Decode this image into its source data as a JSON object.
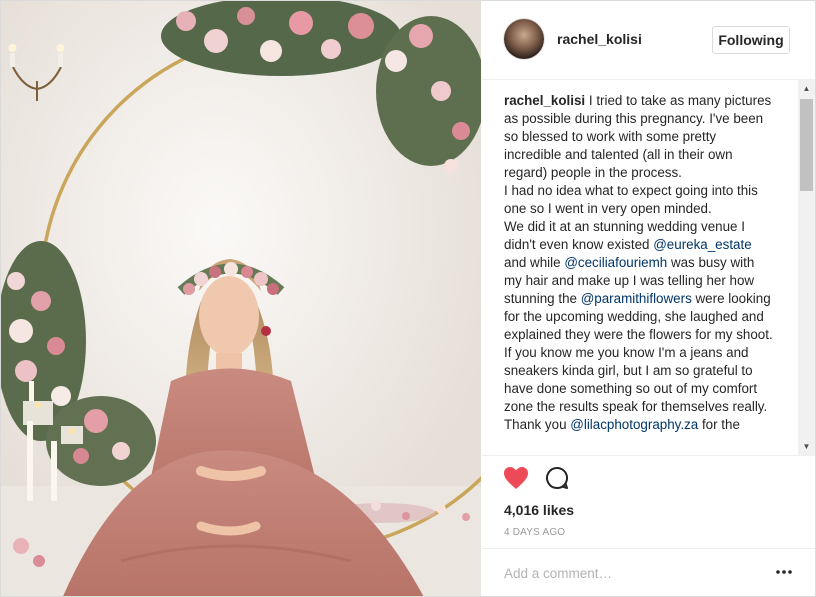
{
  "post": {
    "username": "rachel_kolisi",
    "follow_label": "Following",
    "caption_user": "rachel_kolisi",
    "caption_lines": [
      [
        {
          "t": "I tried to take as many pictures as possible during this pregnancy. I've been so blessed to work with some pretty incredible and talented (all in their own regard) people in the process."
        }
      ],
      [
        {
          "t": "I had no idea what to expect going into this one so I went in very open minded."
        }
      ],
      [
        {
          "t": "We did it at an stunning wedding venue I didn't even know existed "
        },
        {
          "t": "@eureka_estate",
          "m": true
        },
        {
          "t": " and while "
        },
        {
          "t": "@ceciliafouriemh",
          "m": true
        },
        {
          "t": " was busy with my hair and make up I was telling her how stunning the "
        },
        {
          "t": "@paramithiflowers",
          "m": true
        },
        {
          "t": " were looking for the upcoming wedding, she laughed and explained they were the flowers for my shoot. If you know me you know I'm a jeans and sneakers kinda girl, but I am so grateful to have done something so out of my comfort zone the results speak for themselves really. Thank you "
        },
        {
          "t": "@lilacphotography.za",
          "m": true
        },
        {
          "t": " for the"
        }
      ]
    ],
    "likes": "4,016 likes",
    "time_ago": "4 DAYS AGO",
    "comment_placeholder": "Add a comment…"
  },
  "icons": {
    "heart": "heart-icon",
    "comment": "comment-icon",
    "more": "more-options-icon",
    "heart_color": "#ed4956"
  }
}
